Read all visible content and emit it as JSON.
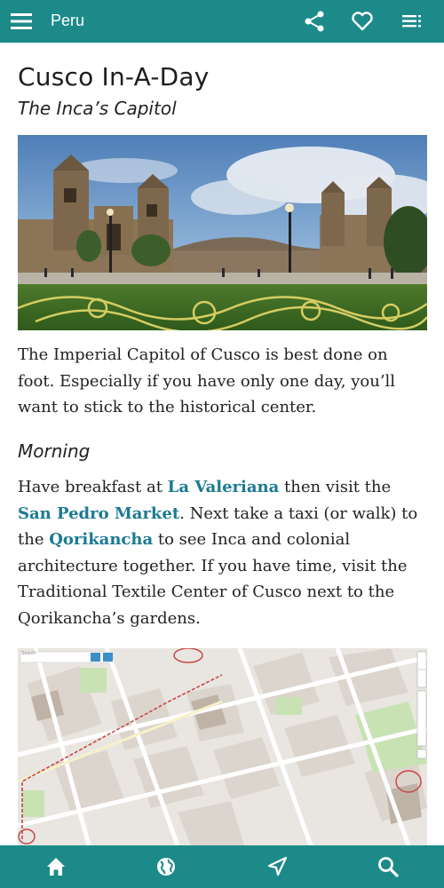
{
  "app": {
    "title": "Peru"
  },
  "toolbar": {
    "menu_icon": "menu-icon",
    "share_icon": "share-icon",
    "favorite_icon": "heart-icon",
    "toc_icon": "list-icon"
  },
  "article": {
    "title": "Cusco In-A-Day",
    "subtitle": "The Inca’s Capitol",
    "intro": "The Imperial Capitol of Cusco is best done on foot. Especially if you have only one day, you’ll want to stick to the historical center.",
    "morning_heading": "Morning",
    "morning": {
      "t1": "Have breakfast at ",
      "link1": "La Valeriana",
      "t2": " then visit the ",
      "link2": "San Pedro Market",
      "t3": ". Next take a taxi (or walk) to the ",
      "link3": "Qorikancha",
      "t4": " to see Inca and colonial architecture together. If you have time, visit the Traditional Textile Center of Cusco next to the Qorikancha’s gardens."
    }
  },
  "map": {
    "search_placeholder": "Search"
  },
  "bottom_nav": {
    "home_icon": "home-icon",
    "globe_icon": "globe-icon",
    "location_icon": "navigation-icon",
    "search_icon": "search-icon"
  },
  "colors": {
    "brand": "#1d8a8a",
    "link": "#1b7a92"
  }
}
